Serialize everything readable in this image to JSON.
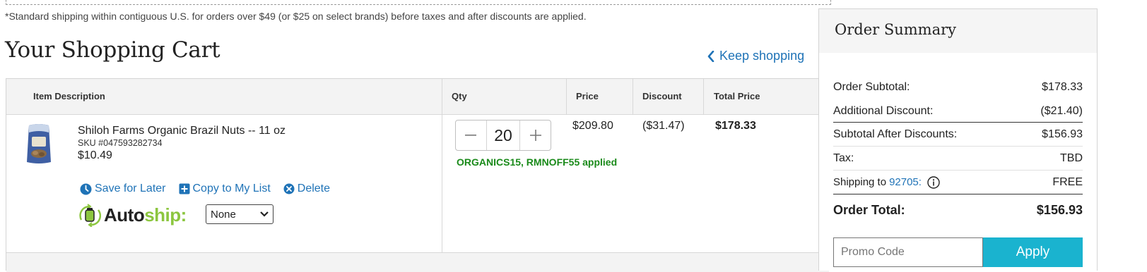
{
  "shipping_note": "*Standard shipping within contiguous U.S. for orders over $49 (or $25 on select brands) before taxes and after discounts are applied.",
  "cart": {
    "title": "Your Shopping Cart",
    "keep_shopping": "Keep shopping",
    "columns": {
      "item_description": "Item Description",
      "qty": "Qty",
      "price": "Price",
      "discount": "Discount",
      "total_price": "Total Price"
    },
    "items": [
      {
        "name": "Shiloh Farms Organic Brazil Nuts -- 11 oz",
        "sku": "SKU #047593282734",
        "unit_price": "$10.49",
        "qty": "20",
        "promo_applied": "ORGANICS15, RMNOFF55 applied",
        "price": "$209.80",
        "discount": "($31.47)",
        "total": "$178.33",
        "actions": {
          "save_for_later": "Save for Later",
          "copy_to_list": "Copy to My List",
          "delete": "Delete"
        },
        "autoship": {
          "label_auto": "Auto",
          "label_ship": "ship:",
          "selected": "None"
        }
      }
    ]
  },
  "summary": {
    "title": "Order Summary",
    "rows": {
      "order_subtotal_label": "Order Subtotal:",
      "order_subtotal_value": "$178.33",
      "additional_discount_label": "Additional Discount:",
      "additional_discount_value": "($21.40)",
      "subtotal_after_label": "Subtotal After Discounts:",
      "subtotal_after_value": "$156.93",
      "tax_label": "Tax:",
      "tax_value": "TBD",
      "shipping_label": "Shipping to",
      "shipping_zip": "92705:",
      "shipping_value": "FREE",
      "order_total_label": "Order Total:",
      "order_total_value": "$156.93"
    },
    "promo_placeholder": "Promo Code",
    "apply_label": "Apply"
  },
  "colors": {
    "link": "#1f73b7",
    "promo_green": "#1a8a1a",
    "autoship_green": "#8cc63f",
    "apply_button": "#1ab3cf"
  }
}
